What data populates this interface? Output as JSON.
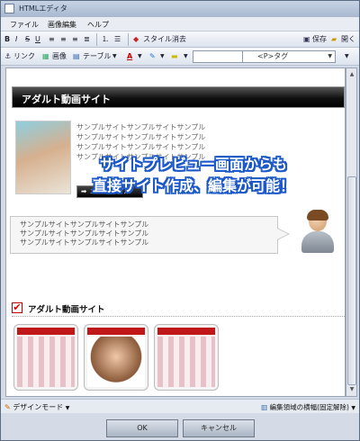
{
  "window": {
    "title": "HTMLエディタ"
  },
  "menu": [
    "ファイル",
    "画像編集",
    "ヘルプ"
  ],
  "toolbar1": {
    "style_clear": "スタイル消去",
    "save": "保存",
    "open": "開く"
  },
  "toolbar2": {
    "link": "リンク",
    "image": "画像",
    "table": "テーブル",
    "tag_combo": "<P>タグ"
  },
  "content": {
    "banner_title": "アダルト動画サイト",
    "sample_lines": [
      "サンプルサイトサンプルサイトサンプル",
      "サンプルサイトサンプルサイトサンプル",
      "サンプルサイトサンプルサイトサンプル",
      "サンプルサイトサンプルサイトサンプル"
    ],
    "ero_button": "エロサンプル",
    "bubble_lines": [
      "サンプルサイトサンプルサイトサンプル",
      "サンプルサイトサンプルサイトサンプル",
      "サンプルサイトサンプルサイトサンプル"
    ],
    "overlay_lines": [
      "サイトプレビュー画面からも",
      "直接サイト作成、編集が可能！"
    ],
    "section2_title": "アダルト動画サイト"
  },
  "statusbar": {
    "mode": "デザインモード",
    "edit_area": "編集領域の横幅(固定解除)"
  },
  "dialog": {
    "ok": "OK",
    "cancel": "キャンセル"
  },
  "colors": {
    "overlay_outline": "#1c59c7",
    "banner_bg": "#000000",
    "accent_red": "#c01818"
  }
}
